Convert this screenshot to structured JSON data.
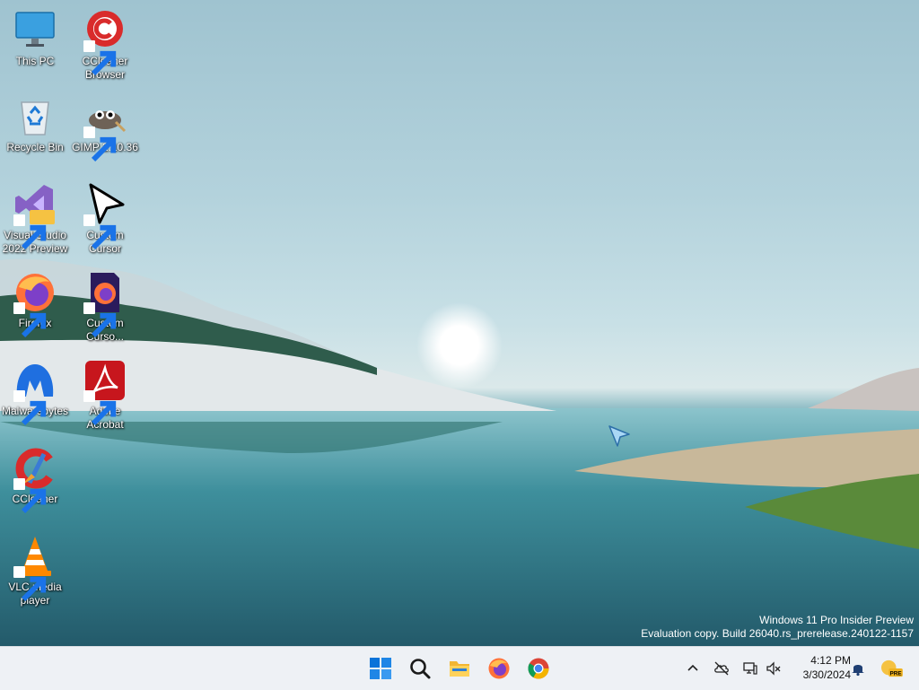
{
  "desktop": {
    "icons": [
      {
        "label": "This PC",
        "icon": "monitor-icon",
        "shortcut": false
      },
      {
        "label": "CCleaner Browser",
        "icon": "ccleaner-browser-icon",
        "shortcut": true
      },
      {
        "label": "Recycle Bin",
        "icon": "recycle-bin-icon",
        "shortcut": false
      },
      {
        "label": "GIMP 2.10.36",
        "icon": "gimp-icon",
        "shortcut": true
      },
      {
        "label": "Visual Studio 2022 Preview",
        "icon": "visual-studio-icon",
        "shortcut": true
      },
      {
        "label": "Custom Cursor",
        "icon": "cursor-arrow-icon",
        "shortcut": true
      },
      {
        "label": "Firefox",
        "icon": "firefox-icon",
        "shortcut": true
      },
      {
        "label": "Custom Curso...",
        "icon": "firefox-alt-icon",
        "shortcut": true
      },
      {
        "label": "Malwarebytes",
        "icon": "malwarebytes-icon",
        "shortcut": true
      },
      {
        "label": "Adobe Acrobat",
        "icon": "acrobat-icon",
        "shortcut": true
      },
      {
        "label": "CCleaner",
        "icon": "ccleaner-icon",
        "shortcut": true
      },
      {
        "label": "VLC media player",
        "icon": "vlc-icon",
        "shortcut": true
      }
    ],
    "watermark": {
      "line1": "Windows 11 Pro Insider Preview",
      "line2": "Evaluation copy. Build 26040.rs_prerelease.240122-1157"
    }
  },
  "taskbar": {
    "apps": [
      {
        "name": "Start",
        "icon": "windows-start-icon"
      },
      {
        "name": "Search",
        "icon": "search-icon"
      },
      {
        "name": "File Explorer",
        "icon": "folder-icon"
      },
      {
        "name": "Firefox",
        "icon": "firefox-icon"
      },
      {
        "name": "Chrome",
        "icon": "chrome-icon"
      }
    ],
    "tray": [
      {
        "icon": "chevron-up-icon"
      },
      {
        "icon": "onedrive-offline-icon"
      },
      {
        "icon": "network-icon"
      },
      {
        "icon": "volume-muted-icon"
      }
    ],
    "clock": {
      "time": "4:12 PM",
      "date": "3/30/2024"
    },
    "notification_icon": "bell-icon",
    "insider_badge": {
      "icon": "insider-pre-icon",
      "text": "PRE"
    }
  },
  "colors": {
    "taskbar_bg": "#eef1f5",
    "accent": "#0067c0"
  }
}
